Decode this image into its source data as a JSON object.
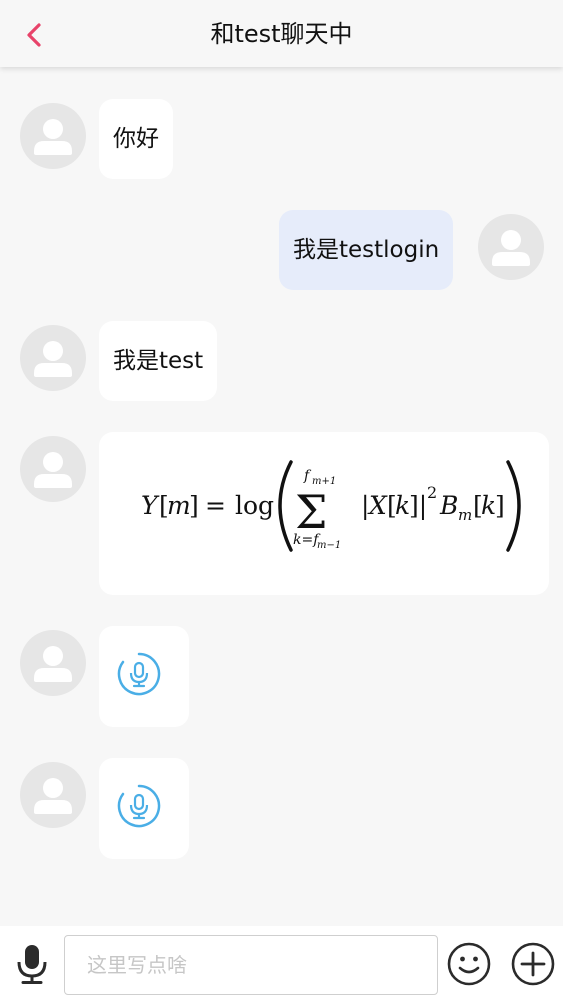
{
  "header": {
    "title": "和test聊天中",
    "back_icon": "chevron-left-icon",
    "accent_color": "#e8436a"
  },
  "messages": [
    {
      "side": "left",
      "type": "text",
      "text": "你好"
    },
    {
      "side": "right",
      "type": "text",
      "text": "我是testlogin"
    },
    {
      "side": "left",
      "type": "text",
      "text": "我是test"
    },
    {
      "side": "left",
      "type": "formula",
      "formula": "Y[m] = log( Σ_{k=f_{m-1}}^{f_{m+1}} |X[k]|² B_m[k] )"
    },
    {
      "side": "left",
      "type": "voice",
      "icon": "voice-message-icon"
    },
    {
      "side": "left",
      "type": "voice",
      "icon": "voice-message-icon"
    }
  ],
  "input_bar": {
    "placeholder": "这里写点啥",
    "mic_icon": "microphone-icon",
    "emoji_icon": "smiley-icon",
    "plus_icon": "plus-circle-icon",
    "voice_color": "#4aaee6"
  }
}
